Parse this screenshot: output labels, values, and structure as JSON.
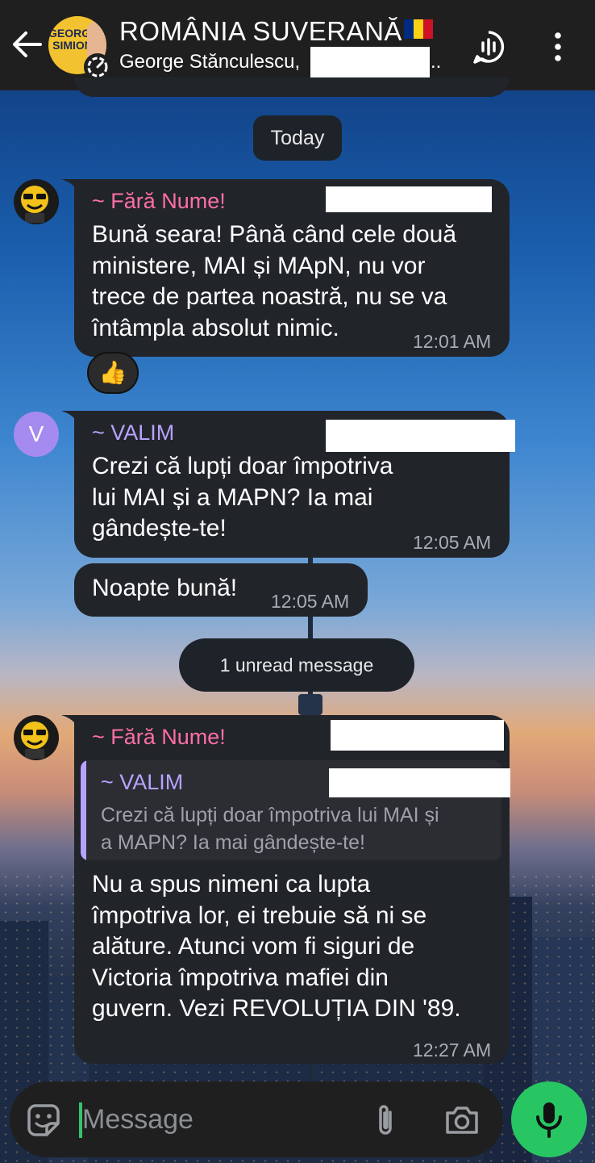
{
  "header": {
    "title": "ROMÂNIA SUVERANĂ",
    "subtitle": "George Stănculescu,",
    "subtitle_ellipsis": "..",
    "avatar_text": "GEORGE SIMION",
    "flag_colors": [
      "#002b7f",
      "#fcd116",
      "#ce1126"
    ]
  },
  "date_separator": "Today",
  "unread_separator": "1 unread message",
  "messages": [
    {
      "sender": "~ Fără Nume!",
      "lines": [
        "Bună seara! Până când cele două",
        "ministere, MAI și MApN, nu vor",
        "trece de partea noastră, nu se va",
        "întâmpla absolut nimic."
      ],
      "time": "12:01 AM",
      "reaction": "👍"
    },
    {
      "sender": "~ VALIM",
      "avatar_letter": "V",
      "lines": [
        "Crezi că lupți doar împotriva",
        "lui MAI și a MAPN? Ia mai",
        "gândește-te!"
      ],
      "time": "12:05 AM"
    },
    {
      "lines": [
        "Noapte bună!"
      ],
      "time": "12:05 AM"
    },
    {
      "sender": "~ Fără Nume!",
      "reply": {
        "sender": "~ VALIM",
        "lines": [
          "Crezi că lupți doar împotriva lui MAI și",
          "a MAPN? Ia mai gândește-te!"
        ]
      },
      "lines": [
        "Nu a spus nimeni ca lupta",
        "împotriva lor, ei trebuie să ni se",
        "alăture. Atunci vom fi siguri de",
        "Victoria împotriva mafiei din",
        "guvern. Vezi REVOLUȚIA DIN '89."
      ],
      "time": "12:27 AM"
    }
  ],
  "composer": {
    "placeholder": "Message"
  },
  "colors": {
    "accent_green": "#27c663",
    "sender_pink": "#ff6fa5",
    "sender_purple": "#b7a2ff",
    "bubble": "#212429"
  }
}
